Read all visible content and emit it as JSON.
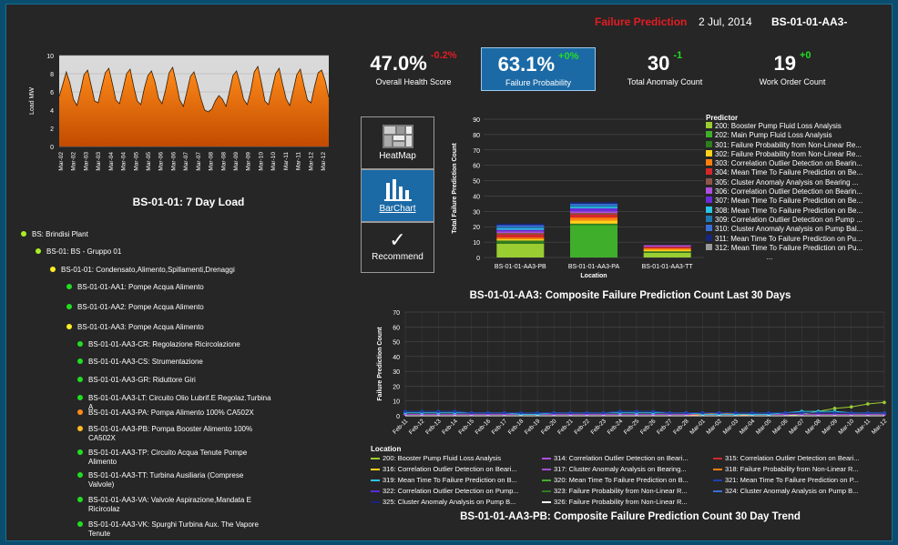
{
  "header": {
    "title": "Failure Prediction",
    "date": "2 Jul, 2014",
    "asset": "BS-01-01-AA3-"
  },
  "colors": {
    "accent_red": "#e31c23",
    "ok_green": "#22dd22",
    "warn_yellow": "#ffee22",
    "warn_orange": "#ff8c1a",
    "selected_blue": "#1b6aa5"
  },
  "kpis": [
    {
      "value": "47.0%",
      "delta": "-0.2%",
      "delta_color": "#e31c23",
      "label": "Overall Health Score"
    },
    {
      "value": "63.1%",
      "delta": "+0%",
      "delta_color": "#22dd22",
      "label": "Failure Probability",
      "selected": true
    },
    {
      "value": "30",
      "delta": "-1",
      "delta_color": "#22dd22",
      "label": "Total Anomaly Count"
    },
    {
      "value": "19",
      "delta": "+0",
      "delta_color": "#22dd22",
      "label": "Work Order Count"
    }
  ],
  "load_chart": {
    "title": "BS-01-01:   7 Day Load",
    "chart_data": {
      "type": "area",
      "ylabel": "Load MW",
      "ylim": [
        0,
        10
      ],
      "yticks": [
        0,
        2,
        4,
        6,
        8,
        10
      ],
      "xticks": [
        "Mar-02",
        "Mar-02",
        "Mar-03",
        "Mar-03",
        "Mar-04",
        "Mar-04",
        "Mar-05",
        "Mar-05",
        "Mar-06",
        "Mar-06",
        "Mar-07",
        "Mar-07",
        "Mar-08",
        "Mar-08",
        "Mar-09",
        "Mar-09",
        "Mar-10",
        "Mar-10",
        "Mar-11",
        "Mar-11",
        "Mar-12",
        "Mar-12"
      ],
      "values": [
        5.5,
        6.8,
        8.2,
        7.0,
        5.2,
        4.5,
        6.1,
        7.9,
        8.4,
        6.7,
        5.0,
        4.8,
        6.5,
        8.1,
        8.6,
        6.9,
        5.1,
        4.7,
        6.3,
        8.0,
        8.5,
        6.6,
        5.0,
        4.6,
        6.4,
        7.8,
        8.3,
        7.1,
        5.3,
        4.7,
        6.2,
        8.1,
        8.7,
        7.0,
        5.1,
        4.4,
        6.0,
        7.7,
        8.2,
        6.8,
        5.2,
        4.0,
        3.8,
        4.1,
        5.0,
        5.6,
        5.2,
        4.4,
        6.0,
        7.8,
        8.3,
        6.9,
        5.2,
        4.6,
        6.1,
        8.2,
        8.8,
        7.0,
        5.0,
        4.6,
        6.3,
        8.0,
        8.6,
        6.8,
        5.2,
        4.5,
        6.2,
        7.9,
        8.5,
        6.7,
        5.1,
        4.8,
        6.6,
        8.1,
        8.4,
        7.2,
        5.4
      ]
    }
  },
  "tree": [
    {
      "label": "BS: Brindisi Plant",
      "color": "#aaee22"
    },
    {
      "label": "BS-01: BS - Gruppo 01",
      "color": "#aaee22"
    },
    {
      "label": "BS-01-01: Condensato,Alimento,Spillamenti,Drenaggi",
      "color": "#ffee22"
    },
    {
      "label": "BS-01-01-AA1: Pompe Acqua Alimento",
      "color": "#22dd22"
    },
    {
      "label": "BS-01-01-AA2: Pompe Acqua Alimento",
      "color": "#22dd22"
    },
    {
      "label": "BS-01-01-AA3: Pompe Acqua Alimento",
      "color": "#ffee22"
    },
    {
      "label": "BS-01-01-AA3-CR: Regolazione Ricircolazione",
      "color": "#22dd22"
    },
    {
      "label": "BS-01-01-AA3-CS: Strumentazione",
      "color": "#22dd22"
    },
    {
      "label": "BS-01-01-AA3-GR: Riduttore Giri",
      "color": "#22dd22"
    },
    {
      "label": "BS-01-01-AA3-LT: Circuito Olio Lubrif.E Regolaz.Turbina",
      "label2": "A",
      "color": "#22dd22"
    },
    {
      "label": "BS-01-01-AA3-PA: Pompa Alimento 100% CA502X",
      "color": "#ff8c1a"
    },
    {
      "label": "BS-01-01-AA3-PB: Pompa Booster Alimento 100%",
      "label2": "CA502X",
      "color": "#ffbb22"
    },
    {
      "label": "BS-01-01-AA3-TP: Circuito Acqua Tenute Pompe",
      "label2": "Alimento",
      "color": "#22dd22"
    },
    {
      "label": "BS-01-01-AA3-TT: Turbina Ausiliaria (Comprese",
      "label2": "Valvole)",
      "color": "#22dd22"
    },
    {
      "label": "BS-01-01-AA3-VA: Valvole Aspirazione,Mandata E",
      "label2": "Ricircolaz",
      "color": "#22dd22"
    },
    {
      "label": "BS-01-01-AA3-VK: Spurghi Turbina Aux. The Vapore",
      "label2": "Tenute",
      "color": "#22dd22"
    }
  ],
  "view_buttons": {
    "heatmap": "HeatMap",
    "barchart": "BarChart",
    "recommend": "Recommend"
  },
  "bar_chart": {
    "title": "BS-01-01-AA3: Composite Failure Prediction Count Last 30 Days",
    "chart_data": {
      "type": "bar",
      "stacked": true,
      "xlabel": "Location",
      "ylabel": "Total Failure Prediction Count",
      "ylim": [
        0,
        90
      ],
      "yticks": [
        0,
        10,
        20,
        30,
        40,
        50,
        60,
        70,
        80,
        90
      ],
      "categories": [
        "BS-01-01-AA3-PB",
        "BS-01-01-AA3-PA",
        "BS-01-01-AA3-TT"
      ],
      "series": [
        {
          "name": "200: Booster Pump Fluid Loss Analysis",
          "color": "#9acd32",
          "values": [
            9,
            0,
            3
          ]
        },
        {
          "name": "202: Main Pump Fluid Loss Analysis",
          "color": "#3fae2a",
          "values": [
            0,
            21,
            0
          ]
        },
        {
          "name": "301: Failure Probability from Non-Linear Re...",
          "color": "#2e7d1f",
          "values": [
            2,
            1,
            1
          ]
        },
        {
          "name": "302: Failure Probability from Non-Linear Re...",
          "color": "#ffd11a",
          "values": [
            1,
            2,
            1
          ]
        },
        {
          "name": "303: Correlation Outlier Detection on Bearin...",
          "color": "#ff7f0e",
          "values": [
            1,
            2,
            1
          ]
        },
        {
          "name": "304: Mean Time To Failure Prediction on Be...",
          "color": "#d62728",
          "values": [
            2,
            2,
            1
          ]
        },
        {
          "name": "305: Cluster Anomaly Analysis on Bearing ...",
          "color": "#8c564b",
          "values": [
            1,
            1,
            0
          ]
        },
        {
          "name": "306: Correlation Outlier Detection on Bearin...",
          "color": "#b04ee0",
          "values": [
            1,
            1,
            1
          ]
        },
        {
          "name": "307: Mean Time To Failure Prediction on Be...",
          "color": "#6a2bd8",
          "values": [
            1,
            2,
            0
          ]
        },
        {
          "name": "308: Mean Time To Failure Prediction on Be...",
          "color": "#2bc4e8",
          "values": [
            1,
            1,
            0
          ]
        },
        {
          "name": "309: Correlation Outlier Detection on Pump ...",
          "color": "#1f77b4",
          "values": [
            1,
            1,
            0
          ]
        },
        {
          "name": "310: Cluster Anomaly Analysis on Pump Bal...",
          "color": "#3a6fd8",
          "values": [
            1,
            1,
            0
          ]
        },
        {
          "name": "311: Mean Time To Failure Prediction on Pu...",
          "color": "#17267a",
          "values": [
            1,
            1,
            0
          ]
        },
        {
          "name": "312: Mean Time To Failure Prediction on Pu...",
          "color": "#999999",
          "values": [
            0,
            0,
            0
          ]
        }
      ]
    },
    "legend_title": "Predictor",
    "legend_more": "..."
  },
  "trend_chart": {
    "title": "BS-01-01-AA3-PB: Composite Failure Prediction Count 30 Day Trend",
    "legend_title": "Location",
    "chart_data": {
      "type": "line",
      "ylabel": "Failure Prediction Count",
      "ylim": [
        0,
        70
      ],
      "yticks": [
        0,
        10,
        20,
        30,
        40,
        50,
        60,
        70
      ],
      "x": [
        "Feb-11",
        "Feb-12",
        "Feb-13",
        "Feb-14",
        "Feb-15",
        "Feb-16",
        "Feb-17",
        "Feb-18",
        "Feb-19",
        "Feb-20",
        "Feb-21",
        "Feb-22",
        "Feb-23",
        "Feb-24",
        "Feb-25",
        "Feb-26",
        "Feb-27",
        "Feb-28",
        "Mar-01",
        "Mar-02",
        "Mar-03",
        "Mar-04",
        "Mar-05",
        "Mar-06",
        "Mar-07",
        "Mar-08",
        "Mar-09",
        "Mar-10",
        "Mar-11",
        "Mar-12"
      ],
      "series": [
        {
          "name": "200: Booster Pump Fluid Loss Analysis",
          "color": "#9acd32",
          "values": [
            0,
            0,
            0,
            0,
            0,
            0,
            0,
            0,
            0,
            0,
            0,
            0,
            0,
            0,
            0,
            0,
            0,
            0,
            0,
            0,
            0,
            0,
            0,
            0,
            1,
            3,
            5,
            6,
            8,
            9
          ]
        },
        {
          "name": "314: Correlation Outlier Detection on Beari...",
          "color": "#b04ee0",
          "values": [
            1,
            1,
            1,
            1,
            1,
            1,
            1,
            1,
            1,
            1,
            1,
            1,
            1,
            1,
            1,
            1,
            1,
            1,
            1,
            1,
            1,
            1,
            1,
            1,
            1,
            1,
            1,
            1,
            1,
            1
          ]
        },
        {
          "name": "315: Correlation Outlier Detection on Beari...",
          "color": "#d62728",
          "values": [
            0,
            0,
            0,
            0,
            0,
            0,
            0,
            0,
            0,
            0,
            0,
            0,
            0,
            0,
            0,
            0,
            0,
            0,
            0,
            0,
            0,
            0,
            0,
            0,
            0,
            0,
            0,
            0,
            0,
            0
          ]
        },
        {
          "name": "316: Correlation Outlier Detection on Beari...",
          "color": "#ffd11a",
          "values": [
            0,
            0,
            0,
            0,
            0,
            0,
            0,
            0,
            0,
            0,
            0,
            0,
            0,
            0,
            0,
            0,
            0,
            0,
            0,
            0,
            0,
            0,
            0,
            0,
            0,
            0,
            0,
            0,
            0,
            0
          ]
        },
        {
          "name": "317: Cluster Anomaly Analysis on Bearing...",
          "color": "#a54fd4",
          "values": [
            0,
            0,
            0,
            0,
            0,
            0,
            0,
            0,
            0,
            0,
            0,
            0,
            0,
            0,
            0,
            0,
            0,
            0,
            0,
            0,
            0,
            0,
            0,
            0,
            0,
            0,
            0,
            0,
            0,
            0
          ]
        },
        {
          "name": "318: Failure Probability from Non-Linear R...",
          "color": "#ff7f0e",
          "values": [
            0,
            0,
            0,
            0,
            0,
            0,
            0,
            0,
            0,
            0,
            0,
            0,
            0,
            0,
            0,
            0,
            0,
            0,
            1,
            2,
            1,
            0,
            0,
            0,
            0,
            0,
            0,
            0,
            0,
            0
          ]
        },
        {
          "name": "319: Mean Time To Failure Prediction on B...",
          "color": "#2bc4e8",
          "values": [
            2,
            2,
            2,
            2,
            2,
            2,
            2,
            1,
            1,
            2,
            2,
            2,
            2,
            2,
            2,
            2,
            2,
            2,
            1,
            1,
            1,
            1,
            1,
            2,
            3,
            3,
            3,
            2,
            2,
            2
          ]
        },
        {
          "name": "320: Mean Time To Failure Prediction on B...",
          "color": "#3fae2a",
          "values": [
            0,
            0,
            0,
            0,
            0,
            0,
            0,
            0,
            0,
            0,
            0,
            0,
            0,
            0,
            0,
            0,
            0,
            0,
            0,
            0,
            0,
            0,
            0,
            0,
            0,
            0,
            0,
            0,
            0,
            0
          ]
        },
        {
          "name": "321: Mean Time To Failure Prediction on P...",
          "color": "#1f3fb4",
          "values": [
            3,
            3,
            3,
            3,
            2,
            2,
            2,
            2,
            2,
            2,
            2,
            2,
            2,
            3,
            3,
            3,
            2,
            2,
            2,
            2,
            2,
            2,
            2,
            2,
            2,
            2,
            2,
            2,
            2,
            2
          ]
        },
        {
          "name": "322: Correlation Outlier Detection on Pump...",
          "color": "#5a2bd8",
          "values": [
            0,
            0,
            0,
            0,
            0,
            0,
            0,
            0,
            0,
            0,
            0,
            0,
            0,
            0,
            0,
            0,
            0,
            0,
            0,
            0,
            0,
            0,
            0,
            0,
            0,
            0,
            0,
            0,
            0,
            0
          ]
        },
        {
          "name": "323: Failure Probability from Non-Linear R...",
          "color": "#2e7d1f",
          "values": [
            0,
            0,
            0,
            0,
            0,
            0,
            0,
            0,
            0,
            0,
            0,
            0,
            0,
            0,
            0,
            0,
            0,
            0,
            0,
            0,
            0,
            0,
            0,
            0,
            0,
            0,
            0,
            0,
            0,
            0
          ]
        },
        {
          "name": "324: Cluster Anomaly Analysis on Pump B...",
          "color": "#3a6fd8",
          "values": [
            0,
            0,
            0,
            0,
            0,
            0,
            0,
            0,
            0,
            0,
            0,
            0,
            0,
            0,
            0,
            0,
            0,
            0,
            0,
            0,
            0,
            0,
            0,
            0,
            0,
            0,
            0,
            0,
            0,
            0
          ]
        },
        {
          "name": "325: Cluster Anomaly Analysis on Pump B...",
          "color": "#17267a",
          "values": [
            0,
            0,
            0,
            0,
            0,
            0,
            0,
            0,
            0,
            0,
            0,
            0,
            0,
            0,
            0,
            0,
            0,
            0,
            0,
            0,
            0,
            0,
            0,
            0,
            0,
            0,
            0,
            0,
            0,
            0
          ]
        },
        {
          "name": "326: Failure Probability from Non-Linear R...",
          "color": "#ffffff",
          "values": [
            0,
            0,
            0,
            0,
            0,
            0,
            0,
            0,
            0,
            0,
            0,
            0,
            0,
            0,
            0,
            0,
            0,
            0,
            0,
            0,
            0,
            0,
            0,
            0,
            0,
            0,
            0,
            0,
            0,
            0
          ]
        }
      ]
    }
  }
}
